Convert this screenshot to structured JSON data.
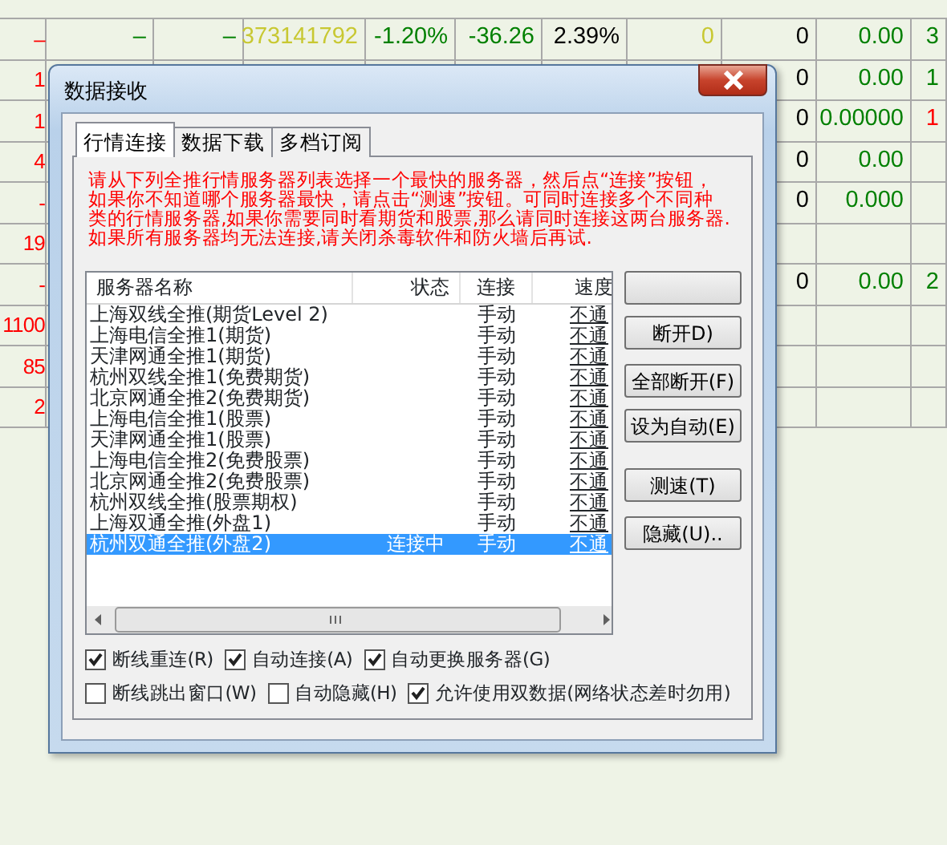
{
  "quote_grid": {
    "rows": [
      {
        "column_1": {
          "text": "–",
          "color": "#ff0000"
        },
        "column_2": {
          "text": "–",
          "color": "#008000"
        },
        "column_3": {
          "text": "–",
          "color": "#008000"
        },
        "column_4": {
          "text": "373141792",
          "color": "#c8c832"
        },
        "column_5": {
          "text": "-1.20%",
          "color": "#008000"
        },
        "column_6": {
          "text": "-36.26",
          "color": "#008000"
        },
        "column_7": {
          "text": "2.39%",
          "color": "#000000"
        },
        "column_8": {
          "text": "0",
          "color": "#c8c832"
        },
        "column_9": {
          "text": "0",
          "color": "#000000"
        },
        "column_10": {
          "text": "0.00",
          "color": "#008000"
        },
        "column_11": {
          "text": "3",
          "color": "#008000"
        }
      },
      {
        "column_1": {
          "text": "1",
          "color": "#ff0000"
        },
        "column_9": {
          "text": "0",
          "color": "#000000"
        },
        "column_10": {
          "text": "0.00",
          "color": "#008000"
        },
        "column_11": {
          "text": "1",
          "color": "#008000"
        }
      },
      {
        "column_1": {
          "text": "1",
          "color": "#ff0000"
        },
        "column_9": {
          "text": "0",
          "color": "#000000"
        },
        "column_10": {
          "text": "0.00000",
          "color": "#008000"
        },
        "column_11": {
          "text": "1",
          "color": "#ff0000"
        }
      },
      {
        "column_1": {
          "text": "4",
          "color": "#ff0000"
        },
        "column_9": {
          "text": "0",
          "color": "#000000"
        },
        "column_10": {
          "text": "0.00",
          "color": "#008000"
        }
      },
      {
        "column_1": {
          "text": "-",
          "color": "#ff0000"
        },
        "column_9": {
          "text": "0",
          "color": "#000000"
        },
        "column_10": {
          "text": "0.000",
          "color": "#008000"
        }
      },
      {
        "column_1": {
          "text": "19",
          "color": "#ff0000"
        }
      },
      {
        "column_1": {
          "text": "-",
          "color": "#ff0000"
        },
        "column_9": {
          "text": "0",
          "color": "#000000"
        },
        "column_10": {
          "text": "0.00",
          "color": "#008000"
        },
        "column_11": {
          "text": "2",
          "color": "#008000"
        }
      },
      {
        "column_1": {
          "text": "1100",
          "color": "#ff0000"
        }
      },
      {
        "column_1": {
          "text": "85",
          "color": "#ff0000"
        }
      },
      {
        "column_1": {
          "text": "2",
          "color": "#ff0000"
        }
      }
    ]
  },
  "dialog": {
    "title": "数据接收",
    "tabs": [
      {
        "label": "行情连接",
        "selected": true
      },
      {
        "label": "数据下载",
        "selected": false
      },
      {
        "label": "多档订阅",
        "selected": false
      }
    ],
    "notice_lines": [
      "请从下列全推行情服务器列表选择一个最快的服务器，然后点“连接”按钮，",
      "如果你不知道哪个服务器最快，请点击“测速”按钮。可同时连接多个不同种",
      "类的行情服务器,如果你需要同时看期货和股票,那么请同时连接这两台服务器.",
      "如果所有服务器均无法连接,请关闭杀毒软件和防火墙后再试."
    ],
    "server_list": {
      "columns": [
        "服务器名称",
        "状态",
        "连接",
        "速度"
      ],
      "rows": [
        {
          "name": "上海双线全推(期货Level 2)",
          "connection": "手动",
          "speed": "不通",
          "selected": false
        },
        {
          "name": "上海电信全推1(期货)",
          "connection": "手动",
          "speed": "不通",
          "selected": false
        },
        {
          "name": "天津网通全推1(期货)",
          "connection": "手动",
          "speed": "不通",
          "selected": false
        },
        {
          "name": "杭州双线全推1(免费期货)",
          "connection": "手动",
          "speed": "不通",
          "selected": false
        },
        {
          "name": "北京网通全推2(免费期货)",
          "connection": "手动",
          "speed": "不通",
          "selected": false
        },
        {
          "name": "上海电信全推1(股票)",
          "connection": "手动",
          "speed": "不通",
          "selected": false
        },
        {
          "name": "天津网通全推1(股票)",
          "connection": "手动",
          "speed": "不通",
          "selected": false
        },
        {
          "name": "上海电信全推2(免费股票)",
          "connection": "手动",
          "speed": "不通",
          "selected": false
        },
        {
          "name": "北京网通全推2(免费股票)",
          "connection": "手动",
          "speed": "不通",
          "selected": false
        },
        {
          "name": "杭州双线全推(股票期权)",
          "connection": "手动",
          "speed": "不通",
          "selected": false
        },
        {
          "name": "上海双通全推(外盘1)",
          "connection": "手动",
          "speed": "不通",
          "selected": false
        },
        {
          "name": "杭州双通全推(外盘2)",
          "status": "连接中",
          "connection": "手动",
          "speed": "不通",
          "selected": true
        }
      ]
    },
    "buttons": [
      {
        "kind": "blank"
      },
      {
        "kind": "labeled",
        "label": "断开D)"
      },
      {
        "kind": "labeled",
        "label": "全部断开(F)"
      },
      {
        "kind": "labeled",
        "label": "设为自动(E)"
      },
      {
        "kind": "labeled",
        "label": "测速(T)"
      },
      {
        "kind": "labeled",
        "label": "隐藏(U).."
      }
    ],
    "option_rows": [
      [
        {
          "label": "断线重连(R)",
          "checked": true
        },
        {
          "label": "自动连接(A)",
          "checked": true
        },
        {
          "label": "自动更换服务器(G)",
          "checked": true
        }
      ],
      [
        {
          "label": "断线跳出窗口(W)",
          "checked": false
        },
        {
          "label": "自动隐藏(H)",
          "checked": false
        },
        {
          "label": "允许使用双数据(网络状态差时勿用)",
          "checked": true
        }
      ]
    ]
  }
}
